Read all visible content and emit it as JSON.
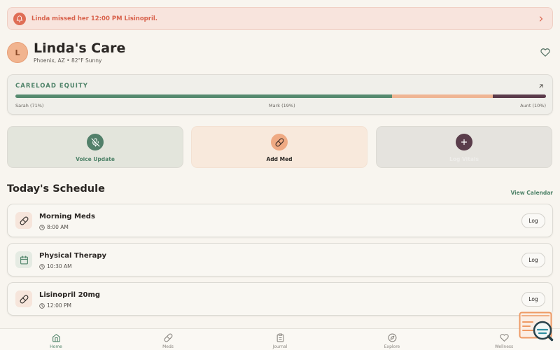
{
  "alert": {
    "text": "Linda missed her 12:00 PM Lisinopril."
  },
  "header": {
    "avatar_initial": "L",
    "title": "Linda's Care",
    "subtitle": "Phoenix, AZ • 82°F Sunny"
  },
  "careload": {
    "title": "CARELOAD EQUITY",
    "segments": [
      {
        "label": "Sarah (71%)",
        "percent": 71,
        "color": "#558a6f"
      },
      {
        "label": "Mark (19%)",
        "percent": 19,
        "color": "#efb594"
      },
      {
        "label": "Aunt (10%)",
        "percent": 10,
        "color": "#5b3b4b"
      }
    ]
  },
  "actions": [
    {
      "label": "Voice Update",
      "icon": "microphone-off-icon"
    },
    {
      "label": "Add Med",
      "icon": "pill-icon"
    },
    {
      "label": "Log Vitals",
      "icon": "plus-icon"
    }
  ],
  "schedule": {
    "title": "Today's Schedule",
    "view_calendar": "View Calendar",
    "items": [
      {
        "name": "Morning Meds",
        "time": "8:00 AM",
        "icon": "pill-icon",
        "button": "Log"
      },
      {
        "name": "Physical Therapy",
        "time": "10:30 AM",
        "icon": "calendar-icon",
        "button": "Log"
      },
      {
        "name": "Lisinopril 20mg",
        "time": "12:00 PM",
        "icon": "pill-icon",
        "button": "Log"
      }
    ]
  },
  "nav": {
    "items": [
      {
        "label": "Home",
        "icon": "home-icon",
        "active": true
      },
      {
        "label": "Meds",
        "icon": "pill-icon",
        "active": false
      },
      {
        "label": "Journal",
        "icon": "clipboard-icon",
        "active": false
      },
      {
        "label": "Explore",
        "icon": "compass-icon",
        "active": false
      },
      {
        "label": "Wellness",
        "icon": "heart-icon",
        "active": false
      }
    ]
  },
  "colors": {
    "accent_green": "#4f8369",
    "alert_red": "#d8614b",
    "peach": "#efb594",
    "plum": "#5b3b4b"
  }
}
